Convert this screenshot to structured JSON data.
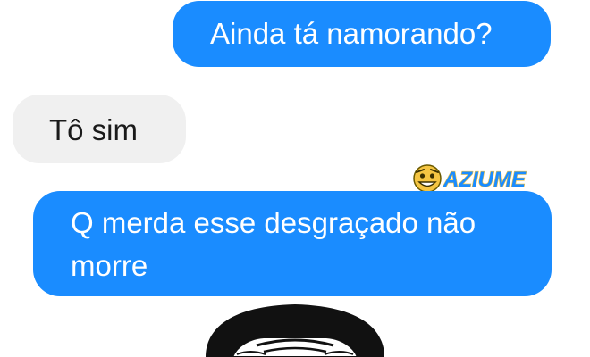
{
  "conversation": {
    "messages": [
      {
        "sender": "me",
        "text": "Ainda tá namorando?"
      },
      {
        "sender": "other",
        "text": "Tô sim"
      },
      {
        "sender": "me",
        "text": "Q merda esse desgraçado não morre"
      }
    ]
  },
  "watermark": {
    "brand": "AZIUME",
    "accent_color": "#1a8cff"
  },
  "colors": {
    "outgoing_bubble": "#1a8cff",
    "incoming_bubble": "#f0f0f0"
  },
  "image": {
    "icon": "meme-face-icon"
  }
}
